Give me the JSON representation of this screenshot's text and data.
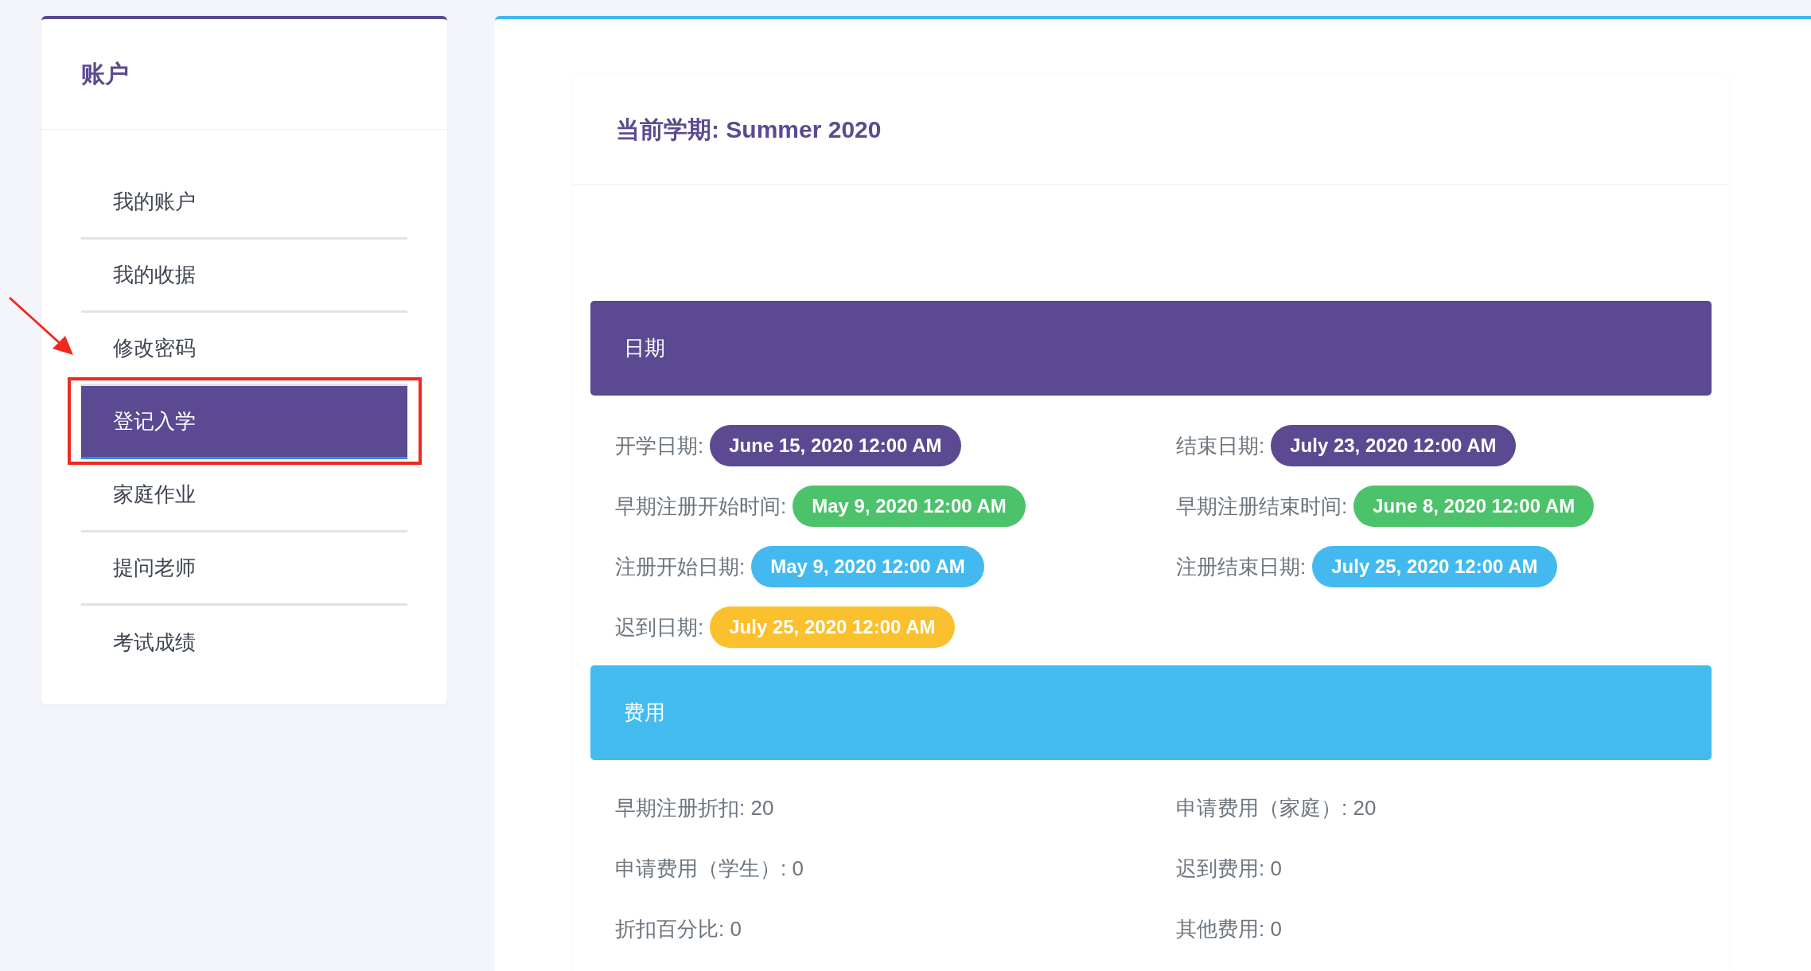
{
  "sidebar": {
    "title": "账户",
    "items": [
      {
        "label": "我的账户",
        "selected": false
      },
      {
        "label": "我的收据",
        "selected": false
      },
      {
        "label": "修改密码",
        "selected": false
      },
      {
        "label": "登记入学",
        "selected": true
      },
      {
        "label": "家庭作业",
        "selected": false
      },
      {
        "label": "提问老师",
        "selected": false
      },
      {
        "label": "考试成绩",
        "selected": false
      }
    ]
  },
  "main": {
    "title": "当前学期: Summer 2020",
    "dates": {
      "heading": "日期",
      "items": [
        {
          "label": "开学日期:",
          "value": "June 15, 2020 12:00 AM",
          "color": "#5b4a91"
        },
        {
          "label": "结束日期:",
          "value": "July 23, 2020 12:00 AM",
          "color": "#5b4a91"
        },
        {
          "label": "早期注册开始时间:",
          "value": "May 9, 2020 12:00 AM",
          "color": "#4cc26a"
        },
        {
          "label": "早期注册结束时间:",
          "value": "June 8, 2020 12:00 AM",
          "color": "#4cc26a"
        },
        {
          "label": "注册开始日期:",
          "value": "May 9, 2020 12:00 AM",
          "color": "#43b9ef"
        },
        {
          "label": "注册结束日期:",
          "value": "July 25, 2020 12:00 AM",
          "color": "#43b9ef"
        },
        {
          "label": "迟到日期:",
          "value": "July 25, 2020 12:00 AM",
          "color": "#fbc02d"
        }
      ]
    },
    "fees": {
      "heading": "费用",
      "items": [
        "早期注册折扣: 20",
        "申请费用（家庭）: 20",
        "申请费用（学生）: 0",
        "迟到费用: 0",
        "折扣百分比: 0",
        "其他费用: 0"
      ]
    }
  }
}
